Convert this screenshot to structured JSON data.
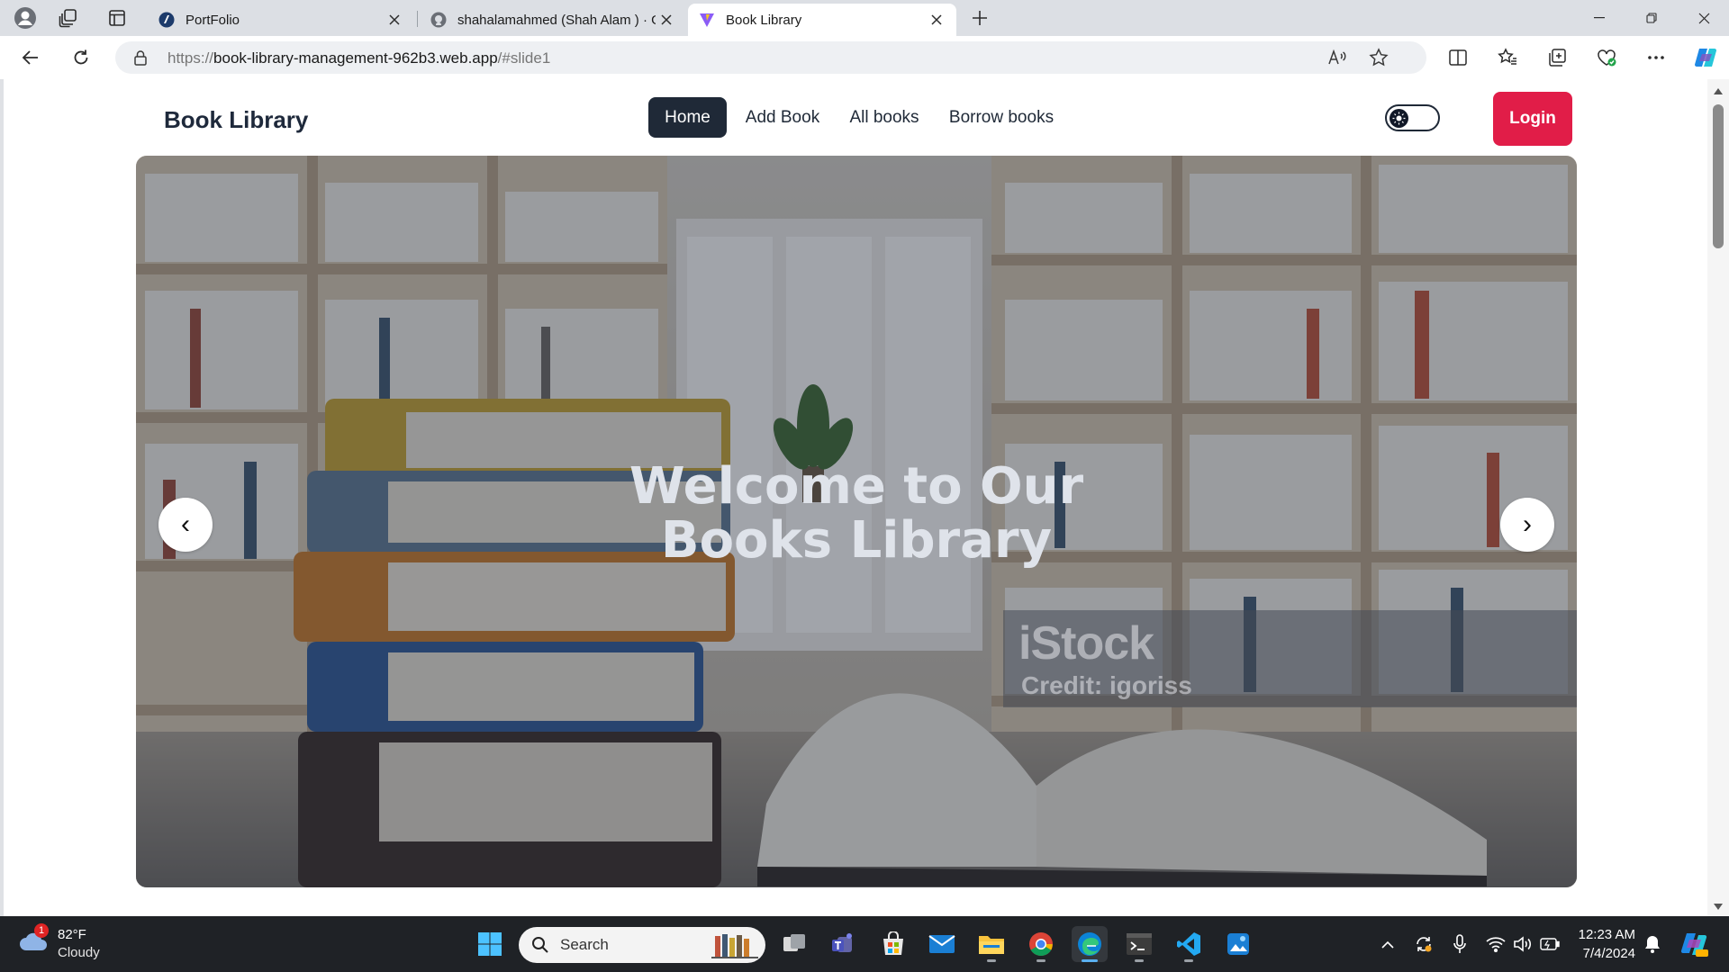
{
  "browser": {
    "tabs": [
      {
        "label": "PortFolio",
        "active": false
      },
      {
        "label": "shahalamahmed (Shah Alam ) · G",
        "active": false
      },
      {
        "label": "Book Library",
        "active": true
      }
    ],
    "url": {
      "prefix": "https://",
      "host": "book-library-management-962b3.web.app",
      "path": "/#slide1"
    }
  },
  "site": {
    "brand": "Book Library",
    "nav": {
      "home": "Home",
      "add_book": "Add Book",
      "all_books": "All books",
      "borrow_books": "Borrow books"
    },
    "login_label": "Login",
    "hero": {
      "title_line1": "Welcome to Our",
      "title_line2": "Books Library",
      "prev_symbol": "‹",
      "next_symbol": "›",
      "watermark_logo": "iStock",
      "watermark_credit": "Credit: igoriss"
    }
  },
  "taskbar": {
    "weather": {
      "temp": "82°F",
      "condition": "Cloudy",
      "badge": "1"
    },
    "search_placeholder": "Search",
    "time": "12:23 AM",
    "date": "7/4/2024"
  },
  "colors": {
    "nav_active": "#1f2937",
    "login": "#e11d48",
    "edge_accent": "#0b84d8"
  }
}
